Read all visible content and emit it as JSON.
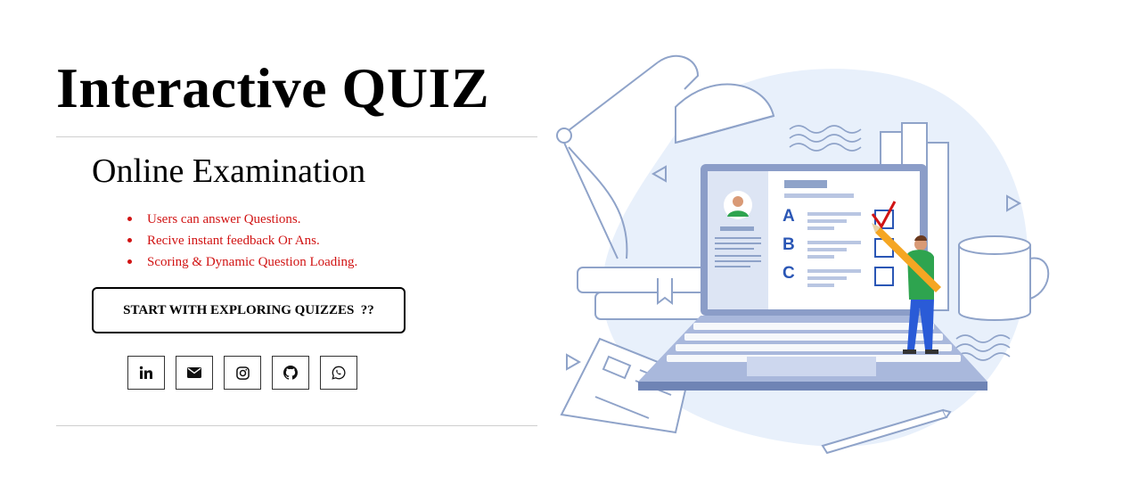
{
  "hero": {
    "title": "Interactive QUIZ",
    "subtitle": "Online Examination",
    "features": [
      "Users can answer Questions.",
      "Recive instant feedback Or Ans.",
      "Scoring & Dynamic Question Loading."
    ],
    "cta_label": "START WITH EXPLORING QUIZZES  ??"
  },
  "socials": [
    {
      "name": "linkedin",
      "icon": "linkedin-icon"
    },
    {
      "name": "email",
      "icon": "envelope-icon"
    },
    {
      "name": "instagram",
      "icon": "instagram-icon"
    },
    {
      "name": "github",
      "icon": "github-icon"
    },
    {
      "name": "whatsapp",
      "icon": "whatsapp-icon"
    }
  ],
  "illustration": {
    "options": [
      "A",
      "B",
      "C"
    ],
    "colors": {
      "accent": "#d11414",
      "line": "#8fa3c9",
      "blob": "#e8f0fb",
      "laptop": "#8b9dc8"
    }
  }
}
